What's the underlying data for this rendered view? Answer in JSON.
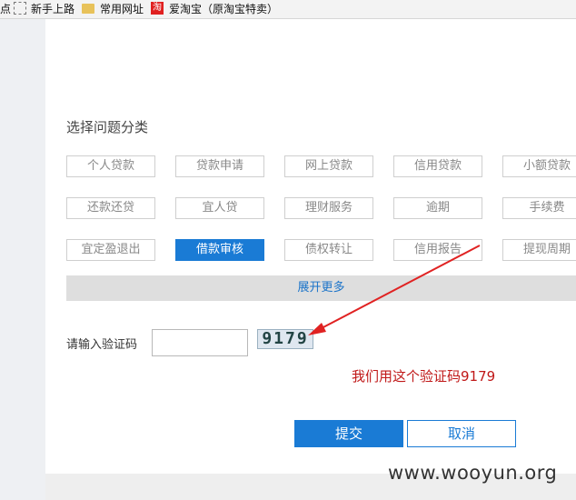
{
  "bookmarks": {
    "items": [
      {
        "label": "点",
        "icon": "none"
      },
      {
        "label": "新手上路",
        "icon": "dashed-page-icon"
      },
      {
        "label": "常用网址",
        "icon": "folder-icon"
      },
      {
        "label": "爱淘宝（原淘宝特卖）",
        "icon": "taobao-icon"
      }
    ]
  },
  "categories": {
    "title": "选择问题分类",
    "items": [
      "个人贷款",
      "贷款申请",
      "网上贷款",
      "信用贷款",
      "小额贷款",
      "还款还贷",
      "宜人贷",
      "理财服务",
      "逾期",
      "手续费",
      "宜定盈退出",
      "借款审核",
      "债权转让",
      "信用报告",
      "提现周期"
    ],
    "selected": "借款审核",
    "expand_label": "展开更多"
  },
  "captcha": {
    "label": "请输入验证码",
    "input_value": "",
    "image_text": "9179"
  },
  "annotation": {
    "text": "我们用这个验证码9179",
    "color": "#c01818"
  },
  "actions": {
    "submit_label": "提交",
    "cancel_label": "取消"
  },
  "watermark": "www.wooyun.org",
  "colors": {
    "accent": "#1a7bd5",
    "annotation": "#c01818"
  }
}
